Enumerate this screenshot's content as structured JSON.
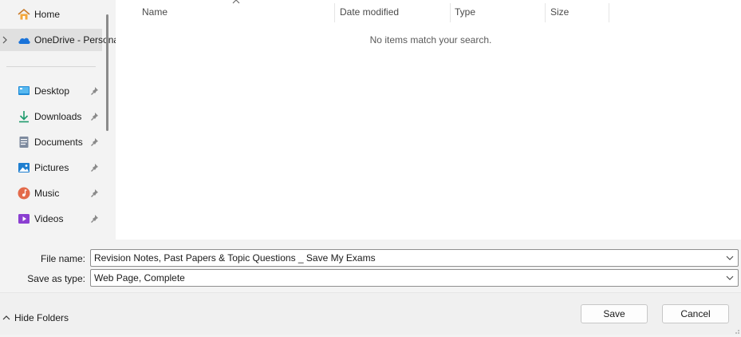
{
  "nav": {
    "items": [
      {
        "label": "Home",
        "icon": "home-icon",
        "pinned": false,
        "expandable": false,
        "selected": false
      },
      {
        "label": "OneDrive - Personal",
        "icon": "cloud-icon",
        "pinned": false,
        "expandable": true,
        "selected": true
      },
      {
        "label": "Desktop",
        "icon": "desktop-icon",
        "pinned": true
      },
      {
        "label": "Downloads",
        "icon": "download-icon",
        "pinned": true
      },
      {
        "label": "Documents",
        "icon": "document-icon",
        "pinned": true
      },
      {
        "label": "Pictures",
        "icon": "picture-icon",
        "pinned": true
      },
      {
        "label": "Music",
        "icon": "music-icon",
        "pinned": true
      },
      {
        "label": "Videos",
        "icon": "video-icon",
        "pinned": true
      }
    ]
  },
  "file_list": {
    "columns": [
      "Name",
      "Date modified",
      "Type",
      "Size"
    ],
    "empty_message": "No items match your search."
  },
  "form": {
    "file_name_label": "File name:",
    "file_name_value": "Revision Notes, Past Papers & Topic Questions _ Save My Exams",
    "save_type_label": "Save as type:",
    "save_type_value": "Web Page, Complete"
  },
  "footer": {
    "hide_folders_label": "Hide Folders",
    "save_label": "Save",
    "cancel_label": "Cancel"
  },
  "colors": {
    "accent": "#0067c0",
    "selected_bg": "#e0e0e0"
  }
}
